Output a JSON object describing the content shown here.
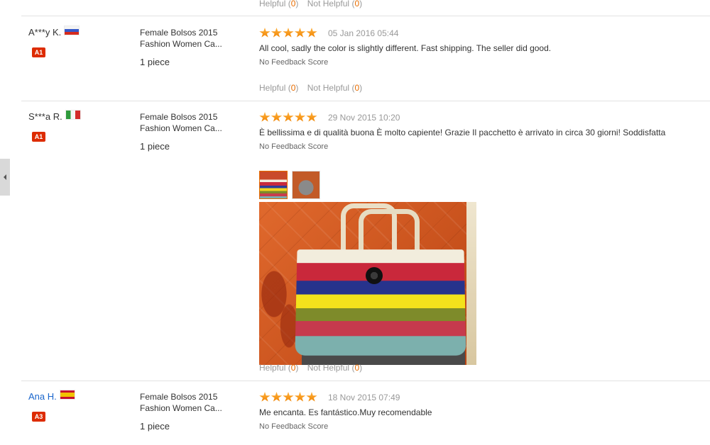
{
  "side_tab": {
    "icon": "caret-left-icon"
  },
  "top_helpful": {
    "label": "Helpful",
    "count": "0",
    "not_label": "Not Helpful",
    "not_count": "0"
  },
  "reviews": [
    {
      "buyer": "A***y K.",
      "flag": "russia-flag-icon",
      "level": "A1",
      "product_line1": "Female Bolsos 2015",
      "product_line2": "Fashion Women Ca...",
      "quantity": "1 piece",
      "stars": 5,
      "date": "05 Jan 2016 05:44",
      "comment": "All cool, sadly the color is slightly different. Fast shipping. The seller did good.",
      "feedback_score": "No Feedback Score",
      "helpful": {
        "label": "Helpful",
        "count": "0",
        "not_label": "Not Helpful",
        "not_count": "0"
      }
    },
    {
      "buyer": "S***a R.",
      "flag": "italy-flag-icon",
      "level": "A1",
      "product_line1": "Female Bolsos 2015",
      "product_line2": "Fashion Women Ca...",
      "quantity": "1 piece",
      "stars": 5,
      "date": "29 Nov 2015 10:20",
      "comment": "È bellissima e di qualità buona È molto capiente! Grazie Il pacchetto è arrivato in circa 30 giorni! Soddisfatta",
      "feedback_score": "No Feedback Score",
      "helpful": {
        "label": "Helpful",
        "count": "0",
        "not_label": "Not Helpful",
        "not_count": "0"
      }
    },
    {
      "buyer": "Ana H.",
      "flag": "spain-flag-icon",
      "level": "A3",
      "product_line1": "Female Bolsos 2015",
      "product_line2": "Fashion Women Ca...",
      "quantity": "1 piece",
      "stars": 5,
      "date": "18 Nov 2015 07:49",
      "comment": "Me encanta. Es fantástico.Muy recomendable",
      "feedback_score": "No Feedback Score"
    }
  ]
}
